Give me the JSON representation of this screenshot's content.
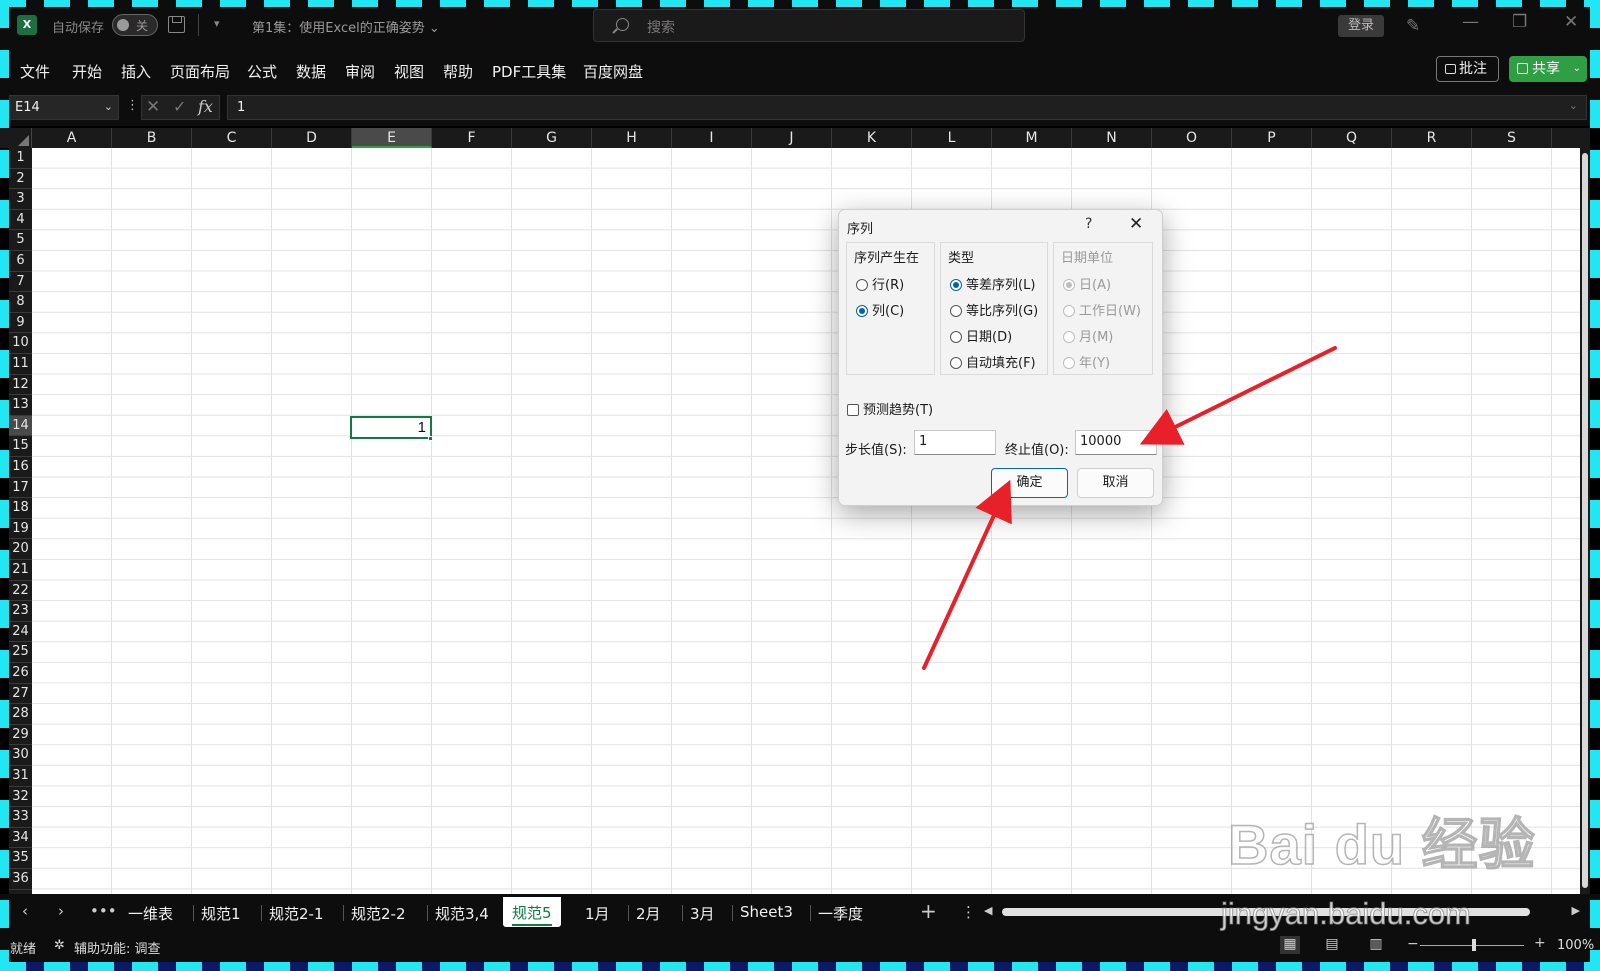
{
  "app": {
    "autosave_label": "自动保存",
    "autosave_state": "关",
    "doc_title": "第1集：使用Excel的正确姿势",
    "search_placeholder": "搜索",
    "login_label": "登录"
  },
  "menu": {
    "items": [
      "文件",
      "开始",
      "插入",
      "页面布局",
      "公式",
      "数据",
      "审阅",
      "视图",
      "帮助",
      "PDF工具集",
      "百度网盘"
    ],
    "comment_label": "批注",
    "share_label": "共享"
  },
  "formula_bar": {
    "name_box": "E14",
    "formula": "1"
  },
  "grid": {
    "columns": [
      "A",
      "B",
      "C",
      "D",
      "E",
      "F",
      "G",
      "H",
      "I",
      "J",
      "K",
      "L",
      "M",
      "N",
      "O",
      "P",
      "Q",
      "R",
      "S"
    ],
    "selected_column": "E",
    "rows": [
      "1",
      "2",
      "3",
      "4",
      "5",
      "6",
      "7",
      "8",
      "9",
      "10",
      "11",
      "12",
      "13",
      "14",
      "15",
      "16",
      "17",
      "18",
      "19",
      "20",
      "21",
      "22",
      "23",
      "24",
      "25",
      "26",
      "27",
      "28",
      "29",
      "30",
      "31",
      "32",
      "33",
      "34",
      "35",
      "36"
    ],
    "selected_row": "14",
    "active_cell_value": "1"
  },
  "dialog": {
    "title": "序列",
    "help": "?",
    "series_in": {
      "title": "序列产生在",
      "options": [
        {
          "label": "行(R)",
          "checked": false
        },
        {
          "label": "列(C)",
          "checked": true
        }
      ]
    },
    "type": {
      "title": "类型",
      "options": [
        {
          "label": "等差序列(L)",
          "checked": true
        },
        {
          "label": "等比序列(G)",
          "checked": false
        },
        {
          "label": "日期(D)",
          "checked": false
        },
        {
          "label": "自动填充(F)",
          "checked": false
        }
      ]
    },
    "date_unit": {
      "title": "日期单位",
      "disabled": true,
      "options": [
        {
          "label": "日(A)",
          "checked": true
        },
        {
          "label": "工作日(W)",
          "checked": false
        },
        {
          "label": "月(M)",
          "checked": false
        },
        {
          "label": "年(Y)",
          "checked": false
        }
      ]
    },
    "trend_label": "预测趋势(T)",
    "step_label": "步长值(S):",
    "step_value": "1",
    "stop_label": "终止值(O):",
    "stop_value": "10000",
    "ok_label": "确定",
    "cancel_label": "取消"
  },
  "sheets": {
    "tabs": [
      "一维表",
      "规范1",
      "规范2-1",
      "规范2-2",
      "规范3,4",
      "规范5",
      "1月",
      "2月",
      "3月",
      "Sheet3",
      "一季度"
    ],
    "active": "规范5"
  },
  "status": {
    "ready": "就绪",
    "accessibility": "辅助功能: 调查",
    "zoom": "100%"
  },
  "watermark": {
    "logo": "Bai du 经验",
    "url": "jingyan.baidu.com"
  },
  "colors": {
    "excel_green": "#107c41",
    "share_green": "#2f9e44",
    "arrow_red": "#e8202a",
    "frame_cyan": "#22e7f3"
  }
}
